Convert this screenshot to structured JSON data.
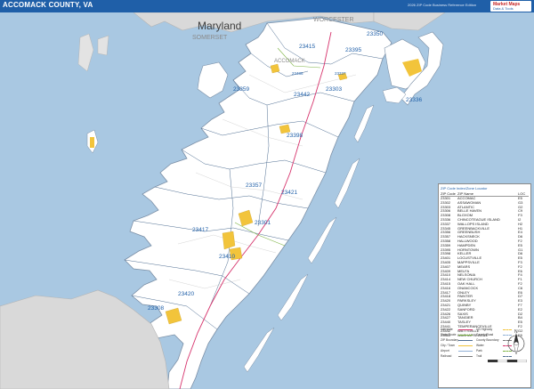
{
  "header": {
    "title": "ACCOMACK COUNTY, VA",
    "subtitle": "2026 ZIP Code Business Reference Edition",
    "logo_line1": "Market Maps",
    "logo_line2": "Data & Tools"
  },
  "map": {
    "states": [
      {
        "name": "Maryland"
      }
    ],
    "counties": [
      "SOMERSET",
      "WORCESTER",
      "ACCOMACK"
    ],
    "zip_labels": [
      {
        "code": "23350"
      },
      {
        "code": "23415"
      },
      {
        "code": "23395"
      },
      {
        "code": "23486"
      },
      {
        "code": "23337"
      },
      {
        "code": "23359"
      },
      {
        "code": "23442"
      },
      {
        "code": "23303"
      },
      {
        "code": "23336"
      },
      {
        "code": "23398"
      },
      {
        "code": "23357"
      },
      {
        "code": "23421"
      },
      {
        "code": "23301"
      },
      {
        "code": "23417"
      },
      {
        "code": "23410"
      },
      {
        "code": "23420"
      },
      {
        "code": "23308"
      }
    ],
    "colors": {
      "water": "#a9c8e2",
      "land": "#ffffff",
      "outside_land": "#d9d9d9",
      "zip_label": "#1f5fa8",
      "town": "#f2c43b",
      "highway": "#d6336c",
      "state_label": "#3d3d3d"
    }
  },
  "legend": {
    "title": "ZIP Code Index/Zone Locator",
    "headers": [
      "ZIP Code",
      "ZIP Name",
      "LOC"
    ],
    "rows": [
      [
        "23301",
        "ACCOMAC",
        "E5"
      ],
      [
        "23302",
        "ASSAWOMAN",
        "G3"
      ],
      [
        "23303",
        "ATLANTIC",
        "G2"
      ],
      [
        "23306",
        "BELLE HAVEN",
        "C9"
      ],
      [
        "23308",
        "BLOXOM",
        "F3"
      ],
      [
        "23336",
        "CHINCOTEAGUE ISLAND",
        "I2"
      ],
      [
        "23337",
        "WALLOPS ISLAND",
        "H2"
      ],
      [
        "23345",
        "GREENBACKVILLE",
        "H1"
      ],
      [
        "23356",
        "GREENBUSH",
        "E4"
      ],
      [
        "23357",
        "HACKSNECK",
        "D6"
      ],
      [
        "23358",
        "HALLWOOD",
        "F2"
      ],
      [
        "23359",
        "HAMPDEN",
        "E5"
      ],
      [
        "23395",
        "HORNTOWN",
        "G1"
      ],
      [
        "23398",
        "KELLER",
        "D6"
      ],
      [
        "23401",
        "LOCUSTVILLE",
        "E5"
      ],
      [
        "23405",
        "MAPPSVILLE",
        "F3"
      ],
      [
        "23407",
        "MEARS",
        "F2"
      ],
      [
        "23409",
        "MELFA",
        "E6"
      ],
      [
        "23410",
        "NELSONIA",
        "F4"
      ],
      [
        "23414",
        "NEW CHURCH",
        "F1"
      ],
      [
        "23415",
        "OAK HALL",
        "F2"
      ],
      [
        "23416",
        "ONANCOCK",
        "C6"
      ],
      [
        "23417",
        "ONLEY",
        "E6"
      ],
      [
        "23418",
        "PAINTER",
        "D7"
      ],
      [
        "23420",
        "PARKSLEY",
        "E3"
      ],
      [
        "23421",
        "QUINBY",
        "F7"
      ],
      [
        "23422",
        "SANFORD",
        "E2"
      ],
      [
        "23426",
        "SAXIS",
        "D2"
      ],
      [
        "23427",
        "TANGIER",
        "B4"
      ],
      [
        "23440",
        "TASLEY",
        "E5"
      ],
      [
        "23441",
        "TEMPERANCEVILLE",
        "F2"
      ],
      [
        "23442",
        "WATTSVILLE",
        "G2"
      ],
      [
        "23480",
        "WACHAPREAGUE",
        "F8"
      ]
    ],
    "key": [
      [
        "Interstate",
        "US Highway"
      ],
      [
        "State Route",
        "County Road"
      ],
      [
        "ZIP Boundary",
        "County Boundary"
      ],
      [
        "City / Town",
        "Water"
      ],
      [
        "Airport",
        "Park"
      ],
      [
        "Railroad",
        "Trail"
      ]
    ]
  },
  "compass": {
    "label": "N"
  }
}
